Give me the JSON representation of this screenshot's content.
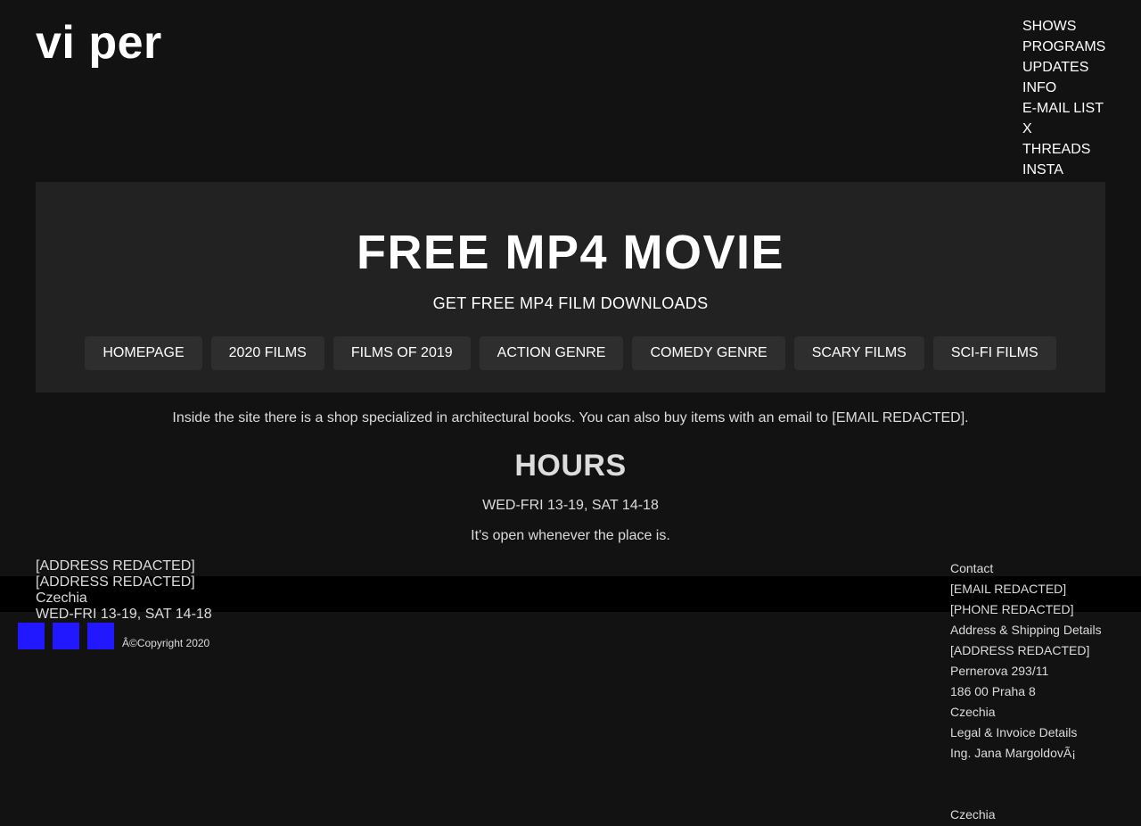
{
  "header": {
    "logo": "vi per",
    "nav": [
      "SHOWS",
      "PROGRAMS",
      "UPDATES",
      "INFO",
      "E-MAIL LIST",
      "X",
      "THREADS",
      "INSTA"
    ]
  },
  "hero": {
    "title": "FREE MP4 MOVIE",
    "subtitle": "GET FREE MP4 FILM DOWNLOADS",
    "buttons": [
      "HOMEPAGE",
      "2020 FILMS",
      "FILMS OF 2019",
      "ACTION GENRE",
      "COMEDY GENRE",
      "SCARY FILMS",
      "SCI-FI FILMS"
    ]
  },
  "intro": "Inside the site there is a shop specialized in architectural books. You can also buy items with an email to [EMAIL REDACTED].",
  "hours": {
    "title": "HOURS",
    "time": "WED-FRI 13-19, SAT 14-18",
    "note": "It's open whenever the place is."
  },
  "footer": {
    "address": [
      "[ADDRESS REDACTED]",
      "[ADDRESS REDACTED]",
      "Czechia",
      "WED-FRI 13-19, SAT 14-18"
    ],
    "copyright": "Â©Copyright 2020",
    "social_color": "#2218ff",
    "contact_top": [
      "Contact",
      "[EMAIL REDACTED]",
      "[PHONE REDACTED]",
      "Address & Shipping Details",
      "[ADDRESS REDACTED]",
      "Pernerova 293/11",
      "186 00 Praha 8",
      "Czechia",
      "Legal & Invoice Details",
      "Ing. Jana MargoldovÃ¡"
    ],
    "contact_bottom": [
      "Czechia"
    ]
  },
  "colors": {
    "background": "#121212",
    "hero_background": "#222222",
    "button_background": "#2e2e2e",
    "band": "#000000"
  }
}
